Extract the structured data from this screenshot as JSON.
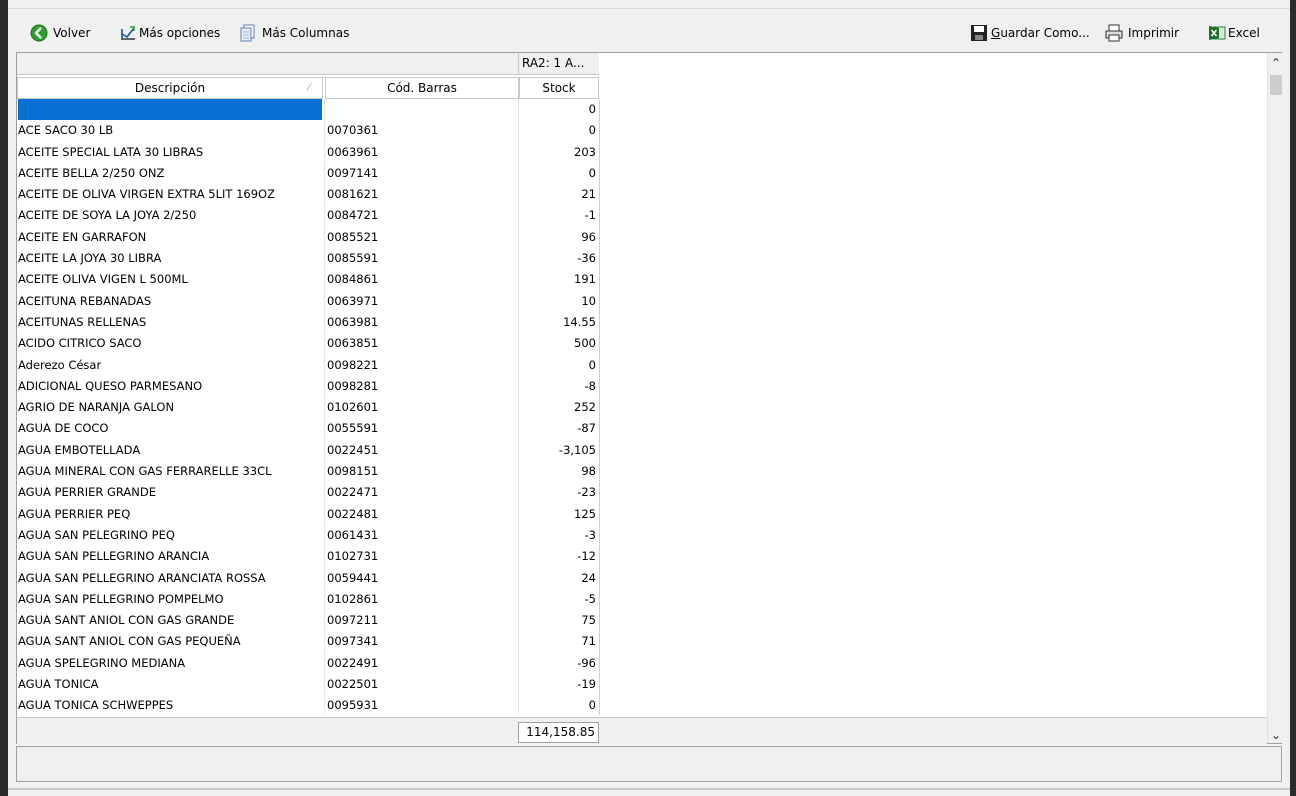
{
  "toolbar": {
    "volver": "Volver",
    "mas_opciones": "Más opciones",
    "mas_columnas": "Más Columnas",
    "guardar_como_prefix": "G",
    "guardar_como_rest": "uardar Como...",
    "imprimir": "Imprimir",
    "excel": "Excel"
  },
  "grid": {
    "group_header": "RA2:  1 A...",
    "columns": {
      "descripcion": "Descripción",
      "cod_barras": "Cód. Barras",
      "stock": "Stock"
    },
    "rows": [
      {
        "desc": "",
        "barcode": "",
        "stock": "0"
      },
      {
        "desc": "ACE SACO 30 LB",
        "barcode": "0070361",
        "stock": "0"
      },
      {
        "desc": "ACEITE  SPECIAL LATA 30 LIBRAS",
        "barcode": "0063961",
        "stock": "203"
      },
      {
        "desc": "ACEITE BELLA 2/250 ONZ",
        "barcode": "0097141",
        "stock": "0"
      },
      {
        "desc": "ACEITE DE OLIVA VIRGEN EXTRA 5LIT 169OZ",
        "barcode": "0081621",
        "stock": "21"
      },
      {
        "desc": "ACEITE DE SOYA LA JOYA 2/250",
        "barcode": "0084721",
        "stock": "-1"
      },
      {
        "desc": "ACEITE EN GARRAFON",
        "barcode": "0085521",
        "stock": "96"
      },
      {
        "desc": "ACEITE LA JOYA 30 LIBRA",
        "barcode": "0085591",
        "stock": "-36"
      },
      {
        "desc": "ACEITE OLIVA VIGEN L 500ML",
        "barcode": "0084861",
        "stock": "191"
      },
      {
        "desc": "ACEITUNA REBANADAS",
        "barcode": "0063971",
        "stock": "10"
      },
      {
        "desc": "ACEITUNAS RELLENAS",
        "barcode": "0063981",
        "stock": "14.55"
      },
      {
        "desc": "ACIDO CITRICO SACO",
        "barcode": "0063851",
        "stock": "500"
      },
      {
        "desc": "Aderezo César",
        "barcode": "0098221",
        "stock": "0"
      },
      {
        "desc": "ADICIONAL QUESO PARMESANO",
        "barcode": "0098281",
        "stock": "-8"
      },
      {
        "desc": "AGRIO  DE NARANJA GALON",
        "barcode": "0102601",
        "stock": "252"
      },
      {
        "desc": "AGUA DE COCO",
        "barcode": "0055591",
        "stock": "-87"
      },
      {
        "desc": "AGUA EMBOTELLADA",
        "barcode": "0022451",
        "stock": "-3,105"
      },
      {
        "desc": "AGUA MINERAL CON GAS FERRARELLE 33CL",
        "barcode": "0098151",
        "stock": "98"
      },
      {
        "desc": "AGUA PERRIER GRANDE",
        "barcode": "0022471",
        "stock": "-23"
      },
      {
        "desc": "AGUA PERRIER PEQ",
        "barcode": "0022481",
        "stock": "125"
      },
      {
        "desc": "AGUA SAN PELEGRINO PEQ",
        "barcode": "0061431",
        "stock": "-3"
      },
      {
        "desc": "AGUA SAN PELLEGRINO ARANCIA",
        "barcode": "0102731",
        "stock": "-12"
      },
      {
        "desc": "AGUA SAN PELLEGRINO ARANCIATA ROSSA",
        "barcode": "0059441",
        "stock": "24"
      },
      {
        "desc": "AGUA SAN PELLEGRINO POMPELMO",
        "barcode": "0102861",
        "stock": "-5"
      },
      {
        "desc": "AGUA SANT ANIOL CON GAS GRANDE",
        "barcode": "0097211",
        "stock": "75"
      },
      {
        "desc": "AGUA SANT ANIOL CON GAS PEQUEÑA",
        "barcode": "0097341",
        "stock": "71"
      },
      {
        "desc": "AGUA SPELEGRINO MEDIANA",
        "barcode": "0022491",
        "stock": "-96"
      },
      {
        "desc": "AGUA TONICA",
        "barcode": "0022501",
        "stock": "-19"
      },
      {
        "desc": "AGUA TONICA SCHWEPPES",
        "barcode": "0095931",
        "stock": "0"
      }
    ],
    "total": "114,158.85"
  },
  "colors": {
    "selection": "#0a70d4",
    "window_bg": "#f0f0f0",
    "grid_bg": "#ffffff"
  },
  "icons": {
    "volver": "back-arrow-icon",
    "mas_opciones": "options-icon",
    "mas_columnas": "columns-icon",
    "guardar": "floppy-disk-icon",
    "imprimir": "printer-icon",
    "excel": "excel-icon"
  }
}
